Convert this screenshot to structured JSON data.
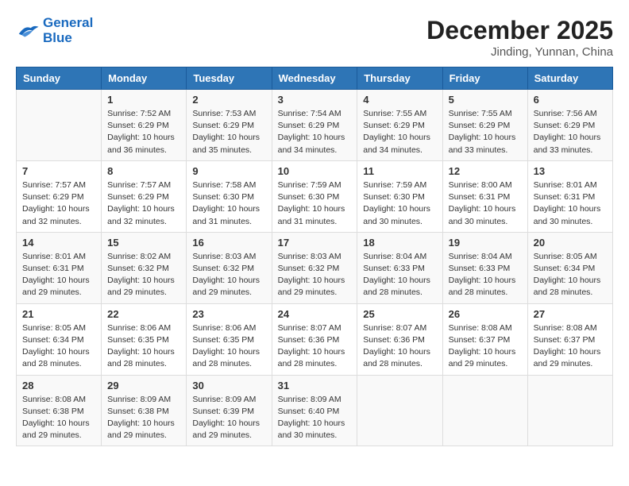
{
  "header": {
    "logo_line1": "General",
    "logo_line2": "Blue",
    "month_year": "December 2025",
    "location": "Jinding, Yunnan, China"
  },
  "weekdays": [
    "Sunday",
    "Monday",
    "Tuesday",
    "Wednesday",
    "Thursday",
    "Friday",
    "Saturday"
  ],
  "weeks": [
    [
      {
        "day": "",
        "info": ""
      },
      {
        "day": "1",
        "info": "Sunrise: 7:52 AM\nSunset: 6:29 PM\nDaylight: 10 hours\nand 36 minutes."
      },
      {
        "day": "2",
        "info": "Sunrise: 7:53 AM\nSunset: 6:29 PM\nDaylight: 10 hours\nand 35 minutes."
      },
      {
        "day": "3",
        "info": "Sunrise: 7:54 AM\nSunset: 6:29 PM\nDaylight: 10 hours\nand 34 minutes."
      },
      {
        "day": "4",
        "info": "Sunrise: 7:55 AM\nSunset: 6:29 PM\nDaylight: 10 hours\nand 34 minutes."
      },
      {
        "day": "5",
        "info": "Sunrise: 7:55 AM\nSunset: 6:29 PM\nDaylight: 10 hours\nand 33 minutes."
      },
      {
        "day": "6",
        "info": "Sunrise: 7:56 AM\nSunset: 6:29 PM\nDaylight: 10 hours\nand 33 minutes."
      }
    ],
    [
      {
        "day": "7",
        "info": "Sunrise: 7:57 AM\nSunset: 6:29 PM\nDaylight: 10 hours\nand 32 minutes."
      },
      {
        "day": "8",
        "info": "Sunrise: 7:57 AM\nSunset: 6:29 PM\nDaylight: 10 hours\nand 32 minutes."
      },
      {
        "day": "9",
        "info": "Sunrise: 7:58 AM\nSunset: 6:30 PM\nDaylight: 10 hours\nand 31 minutes."
      },
      {
        "day": "10",
        "info": "Sunrise: 7:59 AM\nSunset: 6:30 PM\nDaylight: 10 hours\nand 31 minutes."
      },
      {
        "day": "11",
        "info": "Sunrise: 7:59 AM\nSunset: 6:30 PM\nDaylight: 10 hours\nand 30 minutes."
      },
      {
        "day": "12",
        "info": "Sunrise: 8:00 AM\nSunset: 6:31 PM\nDaylight: 10 hours\nand 30 minutes."
      },
      {
        "day": "13",
        "info": "Sunrise: 8:01 AM\nSunset: 6:31 PM\nDaylight: 10 hours\nand 30 minutes."
      }
    ],
    [
      {
        "day": "14",
        "info": "Sunrise: 8:01 AM\nSunset: 6:31 PM\nDaylight: 10 hours\nand 29 minutes."
      },
      {
        "day": "15",
        "info": "Sunrise: 8:02 AM\nSunset: 6:32 PM\nDaylight: 10 hours\nand 29 minutes."
      },
      {
        "day": "16",
        "info": "Sunrise: 8:03 AM\nSunset: 6:32 PM\nDaylight: 10 hours\nand 29 minutes."
      },
      {
        "day": "17",
        "info": "Sunrise: 8:03 AM\nSunset: 6:32 PM\nDaylight: 10 hours\nand 29 minutes."
      },
      {
        "day": "18",
        "info": "Sunrise: 8:04 AM\nSunset: 6:33 PM\nDaylight: 10 hours\nand 28 minutes."
      },
      {
        "day": "19",
        "info": "Sunrise: 8:04 AM\nSunset: 6:33 PM\nDaylight: 10 hours\nand 28 minutes."
      },
      {
        "day": "20",
        "info": "Sunrise: 8:05 AM\nSunset: 6:34 PM\nDaylight: 10 hours\nand 28 minutes."
      }
    ],
    [
      {
        "day": "21",
        "info": "Sunrise: 8:05 AM\nSunset: 6:34 PM\nDaylight: 10 hours\nand 28 minutes."
      },
      {
        "day": "22",
        "info": "Sunrise: 8:06 AM\nSunset: 6:35 PM\nDaylight: 10 hours\nand 28 minutes."
      },
      {
        "day": "23",
        "info": "Sunrise: 8:06 AM\nSunset: 6:35 PM\nDaylight: 10 hours\nand 28 minutes."
      },
      {
        "day": "24",
        "info": "Sunrise: 8:07 AM\nSunset: 6:36 PM\nDaylight: 10 hours\nand 28 minutes."
      },
      {
        "day": "25",
        "info": "Sunrise: 8:07 AM\nSunset: 6:36 PM\nDaylight: 10 hours\nand 28 minutes."
      },
      {
        "day": "26",
        "info": "Sunrise: 8:08 AM\nSunset: 6:37 PM\nDaylight: 10 hours\nand 29 minutes."
      },
      {
        "day": "27",
        "info": "Sunrise: 8:08 AM\nSunset: 6:37 PM\nDaylight: 10 hours\nand 29 minutes."
      }
    ],
    [
      {
        "day": "28",
        "info": "Sunrise: 8:08 AM\nSunset: 6:38 PM\nDaylight: 10 hours\nand 29 minutes."
      },
      {
        "day": "29",
        "info": "Sunrise: 8:09 AM\nSunset: 6:38 PM\nDaylight: 10 hours\nand 29 minutes."
      },
      {
        "day": "30",
        "info": "Sunrise: 8:09 AM\nSunset: 6:39 PM\nDaylight: 10 hours\nand 29 minutes."
      },
      {
        "day": "31",
        "info": "Sunrise: 8:09 AM\nSunset: 6:40 PM\nDaylight: 10 hours\nand 30 minutes."
      },
      {
        "day": "",
        "info": ""
      },
      {
        "day": "",
        "info": ""
      },
      {
        "day": "",
        "info": ""
      }
    ]
  ]
}
